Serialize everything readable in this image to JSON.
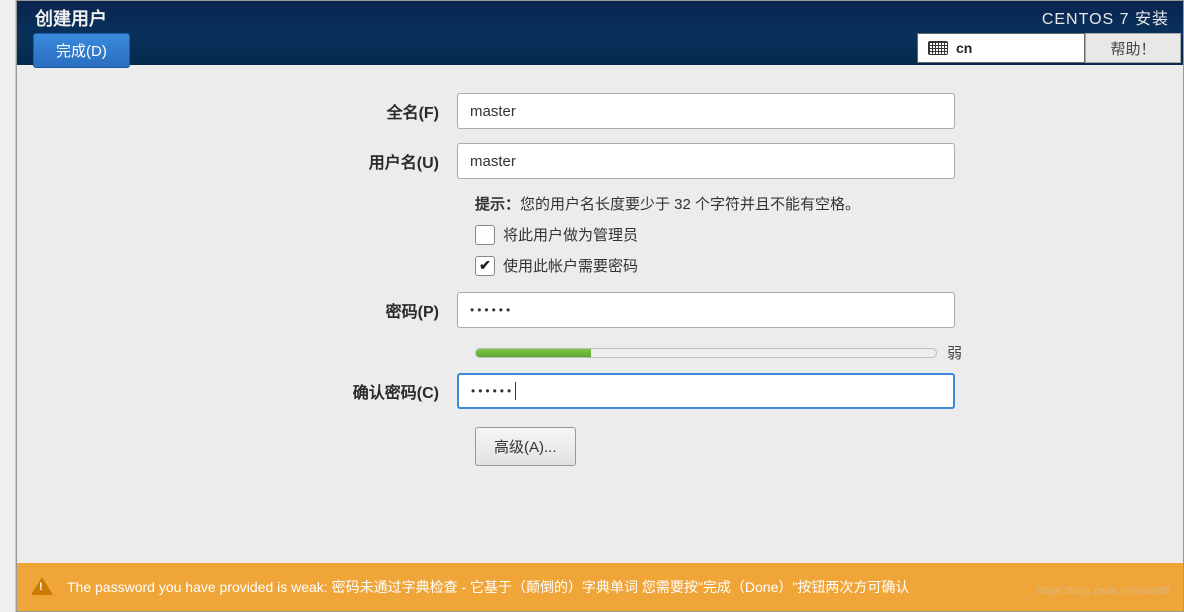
{
  "header": {
    "title": "创建用户",
    "done_label": "完成(D)",
    "install_label": "CENTOS 7 安装",
    "keyboard_layout": "cn",
    "help_label": "帮助！"
  },
  "form": {
    "fullname_label": "全名(F)",
    "fullname_value": "master",
    "username_label": "用户名(U)",
    "username_value": "master",
    "hint_prefix": "提示：",
    "hint_text": "您的用户名长度要少于 32 个字符并且不能有空格。",
    "admin_checkbox_label": "将此用户做为管理员",
    "admin_checked": false,
    "require_password_label": "使用此帐户需要密码",
    "require_password_checked": true,
    "password_label": "密码(P)",
    "password_value": "••••••",
    "strength_label": "弱",
    "strength_percent": 25,
    "confirm_label": "确认密码(C)",
    "confirm_value": "••••••",
    "advanced_label": "高级(A)..."
  },
  "footer": {
    "warning": "The password you have provided is weak: 密码未通过字典检查 - 它基于（颠倒的）字典单词 您需要按\"完成（Done）\"按钮两次方可确认"
  },
  "watermark": "https://blog.csdn.net/scottdt"
}
